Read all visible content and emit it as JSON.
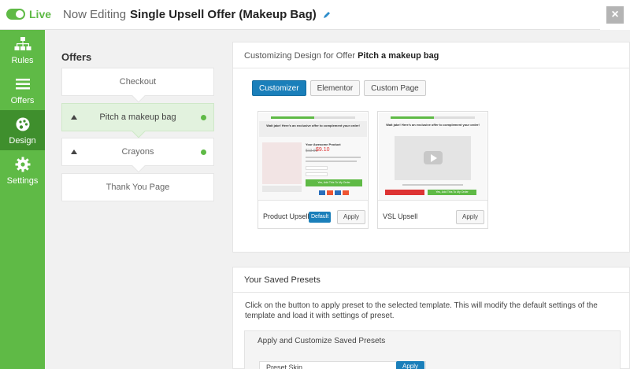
{
  "header": {
    "live_label": "Live",
    "title_prefix": "Now Editing",
    "title_name": "Single Upsell Offer (Makeup Bag)",
    "close_label": "×"
  },
  "sidebar": {
    "items": [
      {
        "label": "Rules",
        "icon": "sitemap-icon"
      },
      {
        "label": "Offers",
        "icon": "list-icon"
      },
      {
        "label": "Design",
        "icon": "palette-icon"
      },
      {
        "label": "Settings",
        "icon": "gear-icon"
      }
    ],
    "active": "Design"
  },
  "offers": {
    "title": "Offers",
    "steps": [
      {
        "label": "Checkout"
      },
      {
        "label": "Pitch a makeup bag"
      },
      {
        "label": "Crayons"
      },
      {
        "label": "Thank You Page"
      }
    ]
  },
  "customize": {
    "heading_prefix": "Customizing Design for Offer",
    "heading_name": "Pitch a makeup bag",
    "buttons": [
      "Customizer",
      "Elementor",
      "Custom Page"
    ],
    "templates": [
      {
        "name": "Product Upsell",
        "badge": "Default",
        "apply": "Apply",
        "preview_banner": "Wait jake! Here's an exclusive offer to complement your order!",
        "preview_product": "Your Awesome Product",
        "preview_old_price": "$13.99",
        "preview_price": "$9.10",
        "preview_cta": "Yes, Add This To My Order"
      },
      {
        "name": "VSL Upsell",
        "apply": "Apply",
        "preview_banner": "Wait jake! Here's an exclusive offer to complement your order!",
        "preview_cta": "Yes, Add This To My Order"
      }
    ]
  },
  "presets": {
    "title": "Your Saved Presets",
    "description": "Click on the button to apply preset to the selected template. This will modify the default settings of the template and load it with settings of preset.",
    "sub_title": "Apply and Customize Saved Presets",
    "preset_value": "Preset Skin",
    "apply": "Apply"
  },
  "colors": {
    "brand_green": "#5fba46",
    "active_green": "#3f8f2d",
    "primary_blue": "#1a7fba"
  }
}
